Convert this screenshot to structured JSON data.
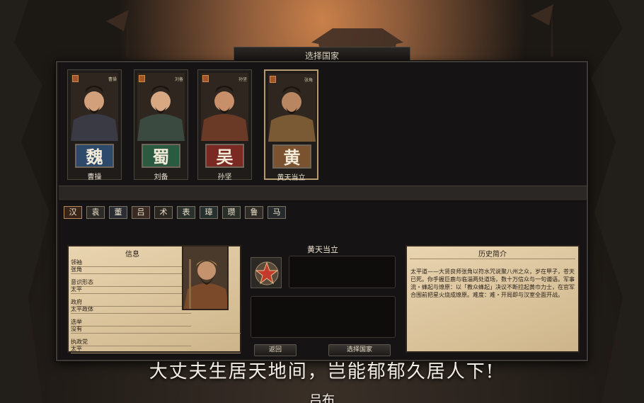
{
  "window": {
    "title": "选择国家"
  },
  "factions": [
    {
      "char": "魏",
      "name": "曹操",
      "subtitle": "曹操",
      "color": "#2d4a6a",
      "selected": false
    },
    {
      "char": "蜀",
      "name": "刘备",
      "subtitle": "刘备",
      "color": "#2a5a40",
      "selected": false
    },
    {
      "char": "吴",
      "name": "孙坚",
      "subtitle": "孙坚",
      "color": "#7a2a22",
      "selected": false
    },
    {
      "char": "黄",
      "name": "黄天当立",
      "subtitle": "张角",
      "color": "#7a5230",
      "selected": true
    }
  ],
  "minor_factions": [
    "汉",
    "袁",
    "董",
    "吕",
    "术",
    "表",
    "璋",
    "瓒",
    "鲁",
    "马"
  ],
  "info_panel": {
    "header": "信息",
    "rows": [
      {
        "label": "领袖",
        "value": "张角"
      },
      {
        "label": "意识形态",
        "value": "太平"
      },
      {
        "label": "政府",
        "value": "太平政体"
      },
      {
        "label": "选举",
        "value": "没有"
      },
      {
        "label": "执政党",
        "value": "太平"
      }
    ]
  },
  "selected_nation": {
    "title": "黄天当立"
  },
  "history": {
    "header": "历史简介",
    "text": "太平道——大贤良师张角以符水咒说聚八州之众，岁在甲子，苍天已死。你手握巨鹿与临淄两处道场，数十万信众与一句谶语。军事流・蜂起与燎原：以「教众蜂起」决议不断拉起黄巾力士，在官军合围前把星火烧成燎原。难度：难・开局即与汉室全面开战。"
  },
  "buttons": {
    "back": "返回",
    "select": "选择国家"
  },
  "quote": {
    "text": "大丈夫生居天地间，岂能郁郁久居人下!",
    "author": "吕布"
  }
}
